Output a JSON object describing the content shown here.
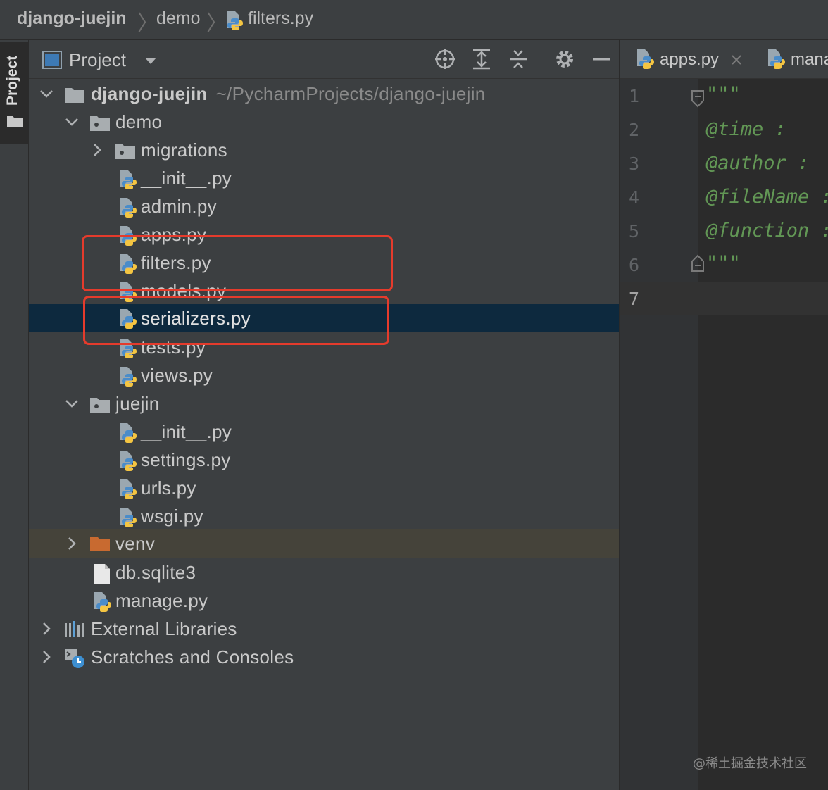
{
  "breadcrumb": [
    "django-juejin",
    "demo",
    "filters.py"
  ],
  "tool_strip": {
    "label": "Project"
  },
  "project_header": {
    "title": "Project",
    "icons": [
      "locate-icon",
      "expand-all-icon",
      "collapse-all-icon",
      "gear-icon",
      "hide-icon"
    ]
  },
  "tree": {
    "root": {
      "name": "django-juejin",
      "path": "~/PycharmProjects/django-juejin"
    },
    "demo": {
      "name": "demo",
      "migrations": "migrations",
      "files": [
        "__init__.py",
        "admin.py",
        "apps.py",
        "filters.py",
        "models.py",
        "serializers.py",
        "tests.py",
        "views.py"
      ]
    },
    "juejin": {
      "name": "juejin",
      "files": [
        "__init__.py",
        "settings.py",
        "urls.py",
        "wsgi.py"
      ]
    },
    "venv": "venv",
    "db": "db.sqlite3",
    "manage": "manage.py",
    "external": "External Libraries",
    "scratches": "Scratches and Consoles"
  },
  "editor": {
    "tabs": [
      "apps.py",
      "mana"
    ],
    "line_numbers": [
      "1",
      "2",
      "3",
      "4",
      "5",
      "6",
      "7"
    ],
    "code_lines": [
      "\"\"\"",
      "@time      :",
      "@author    :",
      "@fileName  :",
      "@function  :",
      "\"\"\""
    ]
  },
  "watermark": "@稀土掘金技术社区",
  "colors": {
    "selection": "#0d293e",
    "highlight_box": "#e53b2c",
    "docstring": "#629755",
    "venv_folder": "#c86a30"
  }
}
